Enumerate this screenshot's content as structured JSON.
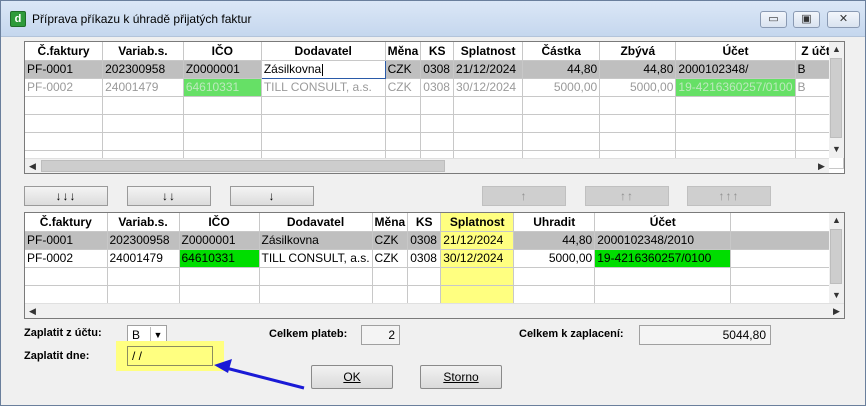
{
  "window": {
    "title": "Příprava příkazu k úhradě přijatých faktur",
    "app_icon": "d",
    "controls": {
      "minimize": "▭",
      "maximize": "▣",
      "close": "✕"
    }
  },
  "top_grid": {
    "columns": [
      "Č.faktury",
      "Variab.s.",
      "IČO",
      "Dodavatel",
      "Měna",
      "KS",
      "Splatnost",
      "Částka",
      "Zbývá",
      "Účet",
      "Z účtu"
    ],
    "rows": [
      [
        "PF-0001",
        "202300958",
        "Z0000001",
        "Zásilkovna",
        "CZK",
        "0308",
        "21/12/2024",
        "44,80",
        "44,80",
        "2000102348/",
        "B"
      ],
      [
        "PF-0002",
        "24001479",
        "64610331",
        "TILL CONSULT, a.s.",
        "CZK",
        "0308",
        "30/12/2024",
        "5000,00",
        "5000,00",
        "19-4216360257/0100",
        "B"
      ]
    ]
  },
  "move_buttons": {
    "add_all": "↓↓↓",
    "add_double": "↓↓",
    "add_one": "↓",
    "remove_one": "↑",
    "remove_double": "↑↑",
    "remove_all": "↑↑↑"
  },
  "bottom_grid": {
    "columns": [
      "Č.faktury",
      "Variab.s.",
      "IČO",
      "Dodavatel",
      "Měna",
      "KS",
      "Splatnost",
      "Uhradit",
      "Účet"
    ],
    "rows": [
      [
        "PF-0001",
        "202300958",
        "Z0000001",
        "Zásilkovna",
        "CZK",
        "0308",
        "21/12/2024",
        "44,80",
        "2000102348/2010"
      ],
      [
        "PF-0002",
        "24001479",
        "64610331",
        "TILL CONSULT, a.s.",
        "CZK",
        "0308",
        "30/12/2024",
        "5000,00",
        "19-4216360257/0100"
      ]
    ]
  },
  "footer": {
    "pay_from_label": "Zaplatit z účtu:",
    "pay_from_value": "B",
    "pay_date_label": "Zaplatit dne:",
    "pay_date_value": " /  /",
    "total_payments_label": "Celkem plateb:",
    "total_payments_value": "2",
    "total_amount_label": "Celkem k zaplacení:",
    "total_amount_value": "5044,80",
    "ok_label": "OK",
    "storno_label": "Storno"
  },
  "colors": {
    "highlight_green": "#00dd00",
    "highlight_yellow": "#ffff80",
    "arrow_blue": "#1a1ad6"
  }
}
